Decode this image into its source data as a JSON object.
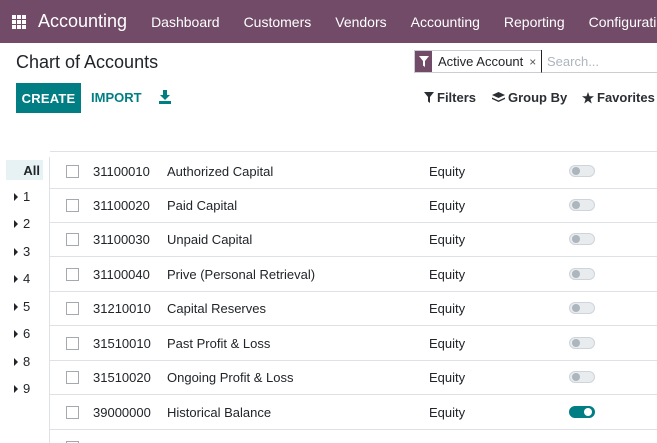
{
  "navbar": {
    "app_name": "Accounting",
    "menu": [
      "Dashboard",
      "Customers",
      "Vendors",
      "Accounting",
      "Reporting",
      "Configuration"
    ]
  },
  "page": {
    "title": "Chart of Accounts"
  },
  "search": {
    "facet": "Active Account",
    "facet_remove": "×",
    "placeholder": "Search..."
  },
  "buttons": {
    "create": "CREATE",
    "import": "IMPORT",
    "filters": "Filters",
    "group_by": "Group By",
    "favorites": "Favorites"
  },
  "sidebar": {
    "items": [
      "All",
      "1",
      "2",
      "3",
      "4",
      "5",
      "6",
      "8",
      "9"
    ]
  },
  "accounts": [
    {
      "code": "31100010",
      "name": "Authorized Capital",
      "type": "Equity",
      "reconcile": false
    },
    {
      "code": "31100020",
      "name": "Paid Capital",
      "type": "Equity",
      "reconcile": false
    },
    {
      "code": "31100030",
      "name": "Unpaid Capital",
      "type": "Equity",
      "reconcile": false
    },
    {
      "code": "31100040",
      "name": "Prive (Personal Retrieval)",
      "type": "Equity",
      "reconcile": false
    },
    {
      "code": "31210010",
      "name": "Capital Reserves",
      "type": "Equity",
      "reconcile": false
    },
    {
      "code": "31510010",
      "name": "Past Profit & Loss",
      "type": "Equity",
      "reconcile": false
    },
    {
      "code": "31510020",
      "name": "Ongoing Profit & Loss",
      "type": "Equity",
      "reconcile": false
    },
    {
      "code": "39000000",
      "name": "Historical Balance",
      "type": "Equity",
      "reconcile": true
    }
  ],
  "colors": {
    "navbar": "#714b67",
    "primary": "#017e84"
  }
}
